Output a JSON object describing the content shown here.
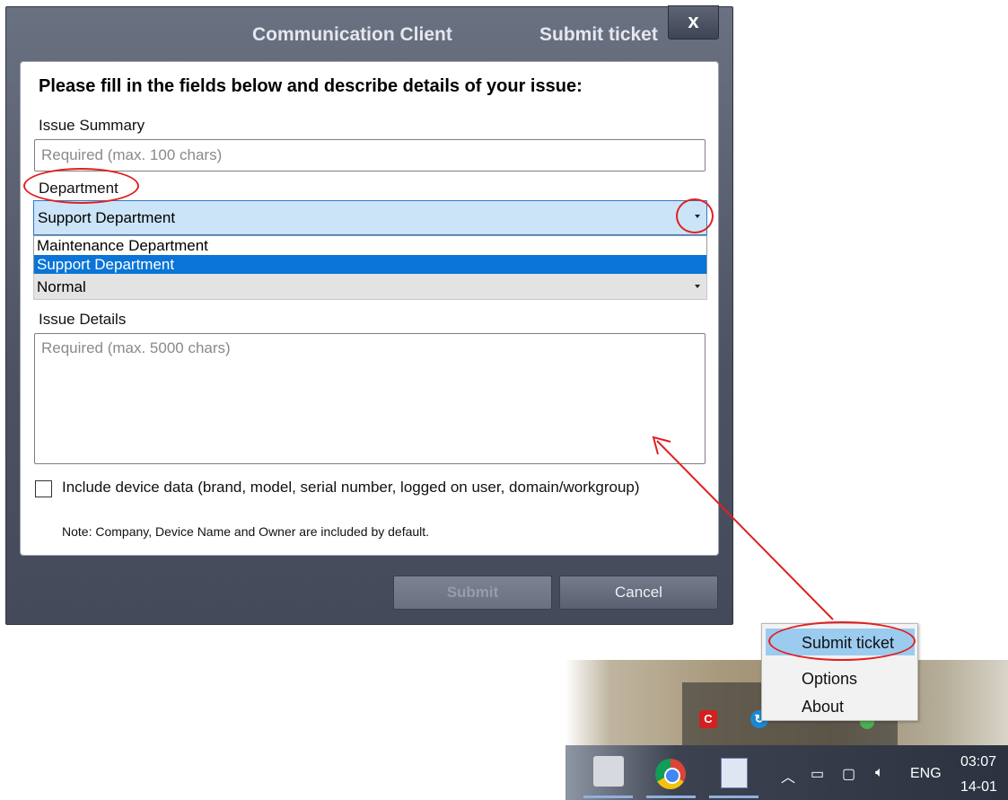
{
  "dialog": {
    "app_title": "Communication Client",
    "window_title": "Submit ticket",
    "close_label": "x"
  },
  "form": {
    "heading": "Please fill in the fields below and describe details of your issue:",
    "issue_summary_label": "Issue Summary",
    "issue_summary_placeholder": "Required (max. 100 chars)",
    "department_label": "Department",
    "department_selected": "Support Department",
    "department_options": [
      "Maintenance Department",
      "Support Department"
    ],
    "priority_value": "Normal",
    "issue_details_label": "Issue Details",
    "issue_details_placeholder": "Required (max. 5000 chars)",
    "include_device_label": "Include device data (brand, model, serial number, logged on user, domain/workgroup)",
    "include_device_checked": false,
    "note": "Note: Company, Device Name and Owner are included by default.",
    "submit_label": "Submit",
    "cancel_label": "Cancel"
  },
  "context_menu": {
    "items": [
      "Submit ticket",
      "Options",
      "About"
    ]
  },
  "taskbar": {
    "language": "ENG",
    "time": "03:07",
    "date": "14-01"
  },
  "icons": {
    "tray_app": "comodo-icon",
    "annotation_color": "#e02020",
    "selection_color": "#0a75d6"
  }
}
